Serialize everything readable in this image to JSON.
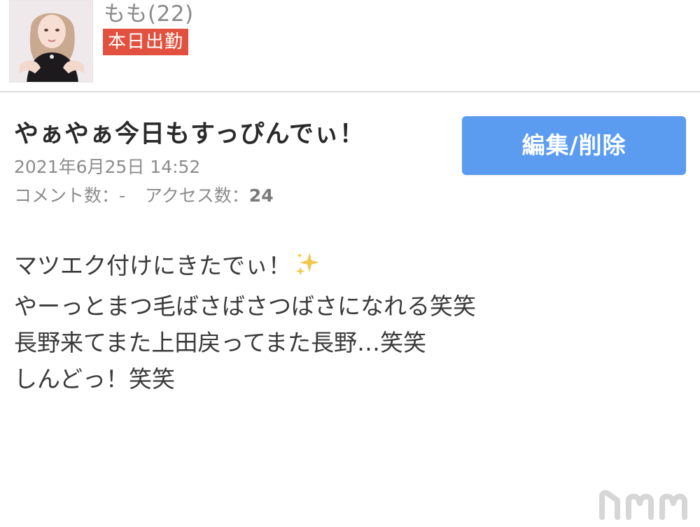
{
  "profile": {
    "name": "もも(22)",
    "status_badge": "本日出勤",
    "avatar_icon": "profile-photo"
  },
  "post": {
    "title": "やぁやぁ今日もすっぴんでぃ！",
    "date": "2021年6月25日 14:52",
    "comments_label": "コメント数：-",
    "access_label": "アクセス数：",
    "access_count": "24",
    "edit_button_label": "編集/削除",
    "body_lines": [
      "マツエク付けにきたでぃ！",
      "やーっとまつ毛ばさばさつばさになれる笑笑",
      "長野来てまた上田戻ってまた長野…笑笑",
      "しんどっ！笑笑"
    ],
    "sparkle_icon": "sparkles-icon"
  },
  "colors": {
    "badge": "#e2513f",
    "button": "#5b9cf0",
    "divider": "#dcdcdc",
    "sparkle": "#f2c94c"
  }
}
